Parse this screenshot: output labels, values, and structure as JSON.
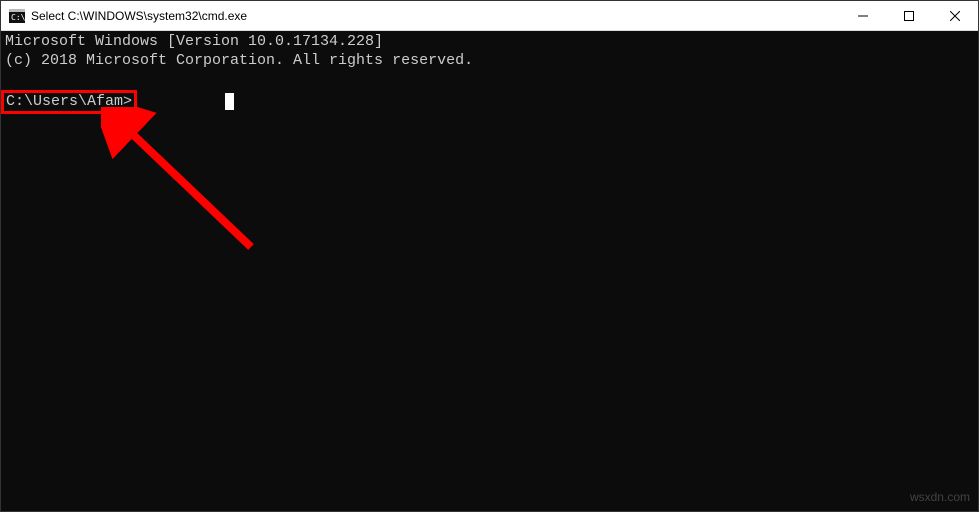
{
  "titlebar": {
    "title": "Select C:\\WINDOWS\\system32\\cmd.exe"
  },
  "terminal": {
    "line1": "Microsoft Windows [Version 10.0.17134.228]",
    "line2": "(c) 2018 Microsoft Corporation. All rights reserved.",
    "prompt": "C:\\Users\\Afam>"
  },
  "watermark": "wsxdn.com",
  "colors": {
    "highlight": "#ff0000",
    "terminal_bg": "#0c0c0c",
    "terminal_fg": "#cccccc"
  }
}
